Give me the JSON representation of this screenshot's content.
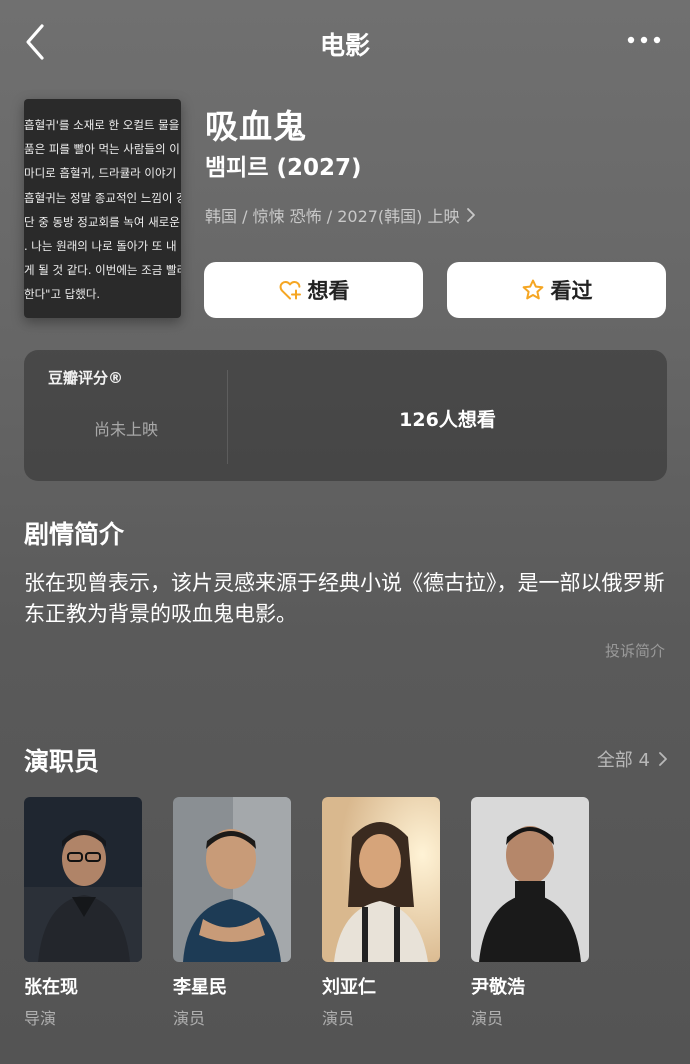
{
  "nav": {
    "title": "电影"
  },
  "poster": {
    "lines": [
      "흡혈귀'를 소재로 한 오컬트 물을 준",
      "품은 피를 빨아 먹는 사람들의 이",
      " 마디로 흡혈귀, 드라큘라 이야기",
      "흡혈귀는 정말 종교적인 느낌이 강",
      "단 중 동방 정교회를 녹여 새로운",
      ". 나는 원래의 나로 돌아가 또 내",
      "게 될 것 같다. 이번에는 조금 빨리",
      "한다\"고 답했다."
    ]
  },
  "movie": {
    "title": "吸血鬼",
    "original_title": "뱀피르 (2027)",
    "meta": "韩国 / 惊悚 恐怖 / 2027(韩国) 上映"
  },
  "actions": {
    "want_label": "想看",
    "seen_label": "看过",
    "accent_color": "#f5a623"
  },
  "rating": {
    "label": "豆瓣评分®",
    "status": "尚未上映",
    "want_count": "126人想看"
  },
  "plot": {
    "heading": "剧情简介",
    "text": "张在现曾表示，该片灵感来源于经典小说《德古拉》，是一部以俄罗斯东正教为背景的吸血鬼电影。",
    "report_label": "投诉简介"
  },
  "cast": {
    "heading": "演职员",
    "all_label": "全部 4",
    "members": [
      {
        "name": "张在现",
        "role": "导演"
      },
      {
        "name": "李星民",
        "role": "演员"
      },
      {
        "name": "刘亚仁",
        "role": "演员"
      },
      {
        "name": "尹敬浩",
        "role": "演员"
      }
    ]
  }
}
